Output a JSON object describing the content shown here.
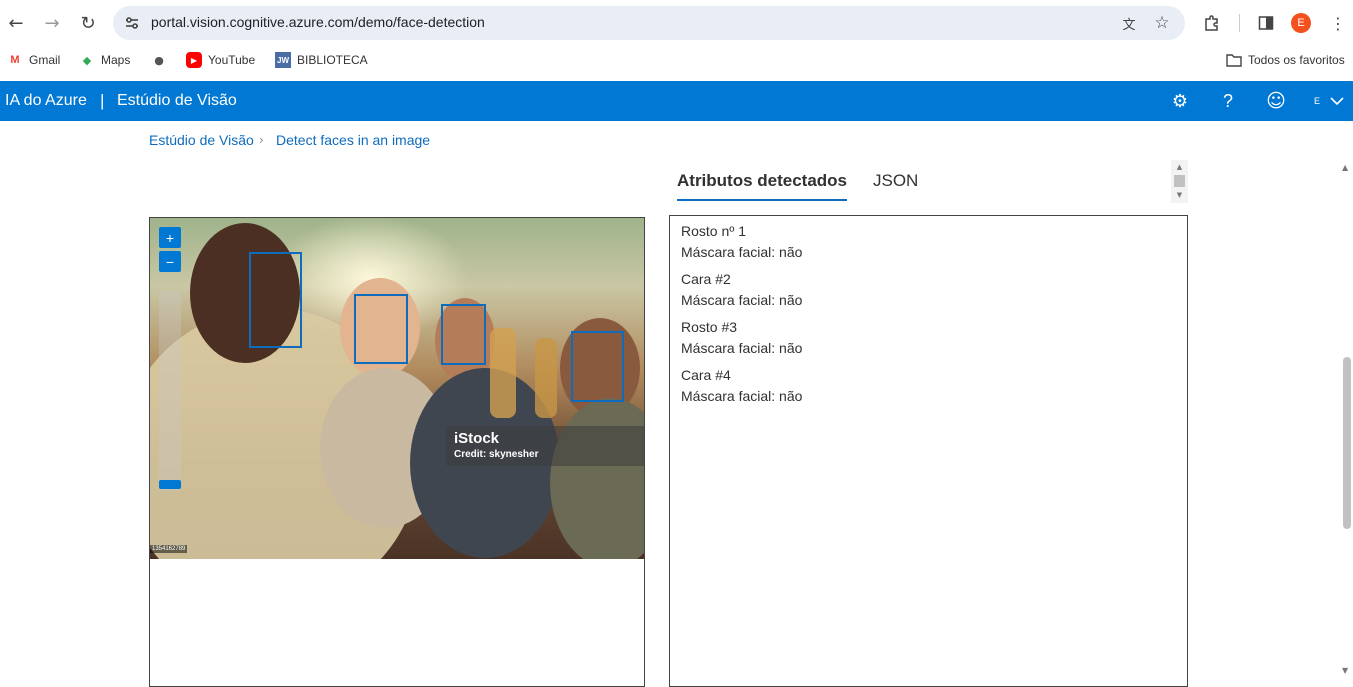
{
  "browser": {
    "url": "portal.vision.cognitive.azure.com/demo/face-detection",
    "profile_initial": "E",
    "bookmarks": [
      {
        "label": "Gmail",
        "icon": "gmail-icon",
        "glyph": "M",
        "color": "#ea4335"
      },
      {
        "label": "Maps",
        "icon": "maps-icon",
        "glyph": "◆",
        "color": "#34a853"
      },
      {
        "label": "",
        "icon": "globe-icon",
        "glyph": "●",
        "color": "#555555"
      },
      {
        "label": "YouTube",
        "icon": "youtube-icon",
        "glyph": "▶",
        "color": "#ff0000"
      },
      {
        "label": "BIBLIOTECA",
        "icon": "jw-icon",
        "glyph": "JW",
        "color": "#4a6da7"
      }
    ],
    "all_bookmarks": "Todos os favoritos"
  },
  "header": {
    "title": "IA do Azure",
    "separator": "|",
    "subtitle": "Estúdio de Visão",
    "profile_initial": "E"
  },
  "breadcrumb": {
    "root": "Estúdio de Visão",
    "current": "Detect faces in an image"
  },
  "tabs": [
    {
      "label": "Atributos detectados",
      "active": true
    },
    {
      "label": "JSON",
      "active": false
    }
  ],
  "image": {
    "watermark": "iStock",
    "credit": "Credit: skynesher",
    "stock_id": "1354162789",
    "zoom_in": "+",
    "zoom_out": "−"
  },
  "faces": [
    {
      "title": "Rosto nº 1",
      "mask": "Máscara facial: não"
    },
    {
      "title": "Cara #2",
      "mask": "Máscara facial: não"
    },
    {
      "title": "Rosto #3",
      "mask": "Máscara facial: não"
    },
    {
      "title": "Cara #4",
      "mask": "Máscara facial: não"
    }
  ],
  "colors": {
    "accent": "#0078d4",
    "link": "#0f6cbd",
    "face_box": "#0f6cbd"
  }
}
